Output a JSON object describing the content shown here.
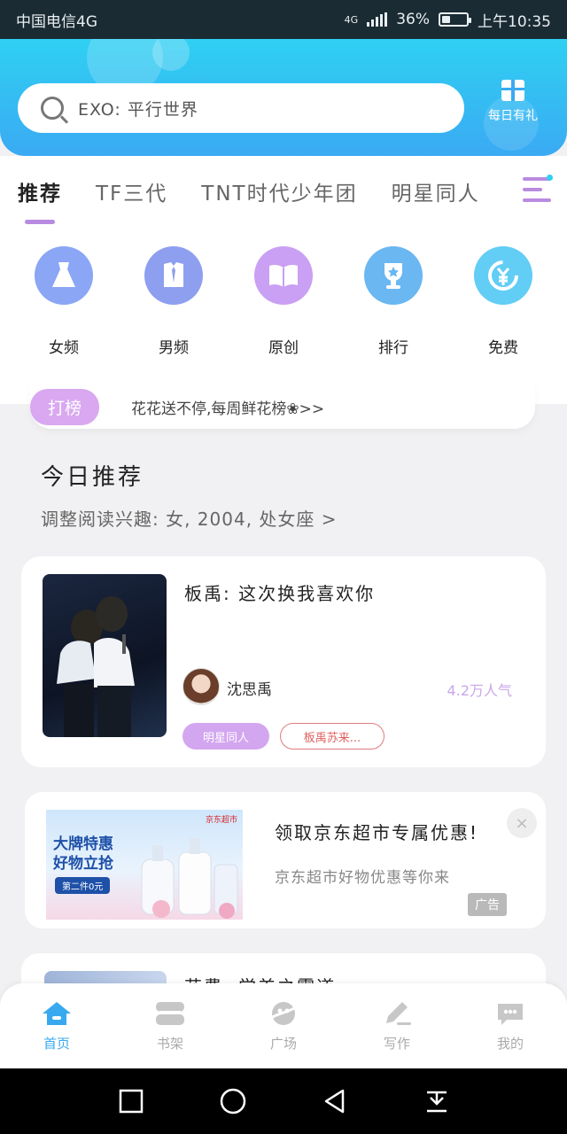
{
  "status_bar": {
    "carrier": "中国电信4G",
    "network": "4G",
    "battery": "36%",
    "battery_level": 0.36,
    "time": "上午10:35"
  },
  "header": {
    "search_placeholder": "EXO: 平行世界",
    "daily_gift_label": "每日有礼"
  },
  "tabs": [
    "推荐",
    "TF三代",
    "TNT时代少年团",
    "明星同人"
  ],
  "categories": [
    {
      "label": "女频",
      "icon": "dress-icon",
      "color": "#8aa6f5"
    },
    {
      "label": "男频",
      "icon": "shirt-icon",
      "color": "#8e9ff0"
    },
    {
      "label": "原创",
      "icon": "book-icon",
      "color": "#c9a0f3"
    },
    {
      "label": "排行",
      "icon": "trophy-icon",
      "color": "#6ab7f1"
    },
    {
      "label": "免费",
      "icon": "coin-icon",
      "color": "#62cdf5"
    }
  ],
  "ranking": {
    "badge": "打榜",
    "text": "花花送不停,每周鲜花榜❀>>"
  },
  "today": {
    "title": "今日推荐",
    "subtitle": "调整阅读兴趣: 女, 2004, 处女座 >"
  },
  "book": {
    "title": "板禹: 这次换我喜欢你",
    "author": "沈思禹",
    "popularity": "4.2万人气",
    "tags": [
      "明星同人",
      "板禹苏来..."
    ]
  },
  "ad": {
    "banner_line1": "大牌特惠",
    "banner_line2": "好物立抢",
    "banner_pill": "第二件0元",
    "brand": "京东超市",
    "title": "领取京东超市专属优惠!",
    "subtitle": "京东超市好物优惠等你来",
    "ad_label": "广告",
    "close": "×"
  },
  "next_book": {
    "title": "花费: 学美之雾道"
  },
  "bottom_nav": [
    {
      "label": "首页",
      "icon": "home-icon",
      "active": true
    },
    {
      "label": "书架",
      "icon": "bookshelf-icon",
      "active": false
    },
    {
      "label": "广场",
      "icon": "planet-icon",
      "active": false
    },
    {
      "label": "写作",
      "icon": "pen-icon",
      "active": false
    },
    {
      "label": "我的",
      "icon": "chat-bubble-icon",
      "active": false
    }
  ],
  "colors": {
    "accent": "#38a9ef",
    "purple": "#b98be0",
    "header_top": "#2fd0f2",
    "header_bottom": "#3aaaf3"
  }
}
